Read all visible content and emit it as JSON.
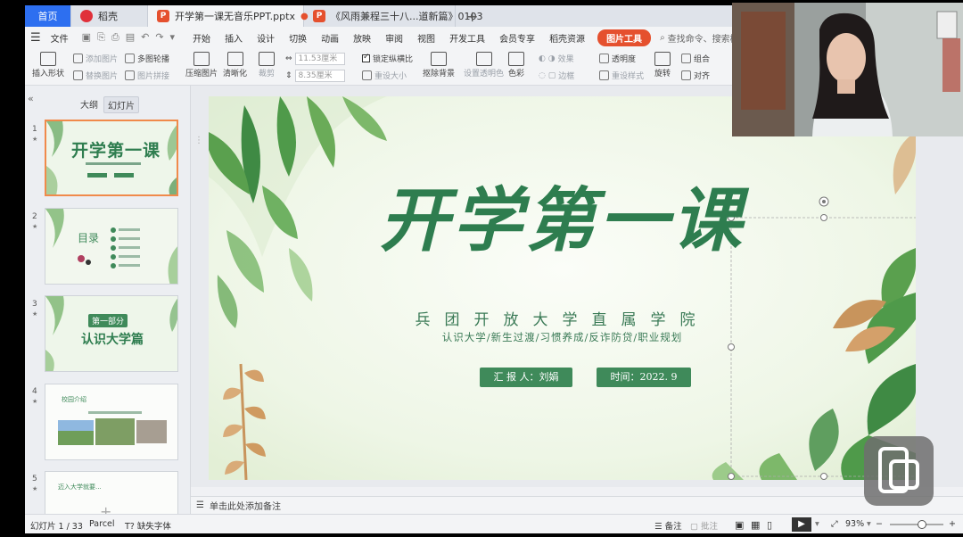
{
  "tabs": {
    "home": "首页",
    "wps": "稻壳",
    "active_doc": "开学第一课无音乐PPT.pptx",
    "other_doc": "《风雨兼程三十八...道新篇》0103",
    "add": "+"
  },
  "menubar": {
    "file": "文件",
    "items": [
      "开始",
      "插入",
      "设计",
      "切换",
      "动画",
      "放映",
      "审阅",
      "视图",
      "开发工具",
      "会员专享",
      "稻壳资源"
    ],
    "picture_tools": "图片工具",
    "search": "查找命令、搜索模板"
  },
  "ribbon": {
    "insert_shape": "插入形状",
    "add_picture": "添加图片",
    "multi_outline": "多图轮播",
    "replace_picture": "替换图片",
    "picture_combine": "图片拼接",
    "compress": "压缩图片",
    "sharpen": "清晰化",
    "crop": "裁剪",
    "width": "11.53厘米",
    "height": "8.35厘米",
    "lock_ratio": "锁定纵横比",
    "reset_size": "重设大小",
    "remove_bg": "抠除背景",
    "set_transparent": "设置透明色",
    "color": "色彩",
    "effects": "效果",
    "transparency": "透明度",
    "border": "边框",
    "reset_style": "重设样式",
    "rotate": "旋转",
    "group": "组合",
    "align": "对齐"
  },
  "panel": {
    "outline_tab": "大纲",
    "slides_tab": "幻灯片",
    "thumbs": [
      {
        "num": "1",
        "title": "开学第一课"
      },
      {
        "num": "2",
        "title": "目录"
      },
      {
        "num": "3",
        "badge": "第一部分",
        "title": "认识大学篇"
      },
      {
        "num": "4",
        "title": "校园介绍"
      },
      {
        "num": "5",
        "title": "迈入大学就要..."
      }
    ]
  },
  "slide": {
    "title": "开学第一课",
    "college": "兵团开放大学直属学院",
    "subtitle": "认识大学/新生过渡/习惯养成/反诈防贷/职业规划",
    "reporter": "汇 报 人：刘娟",
    "time": "时间：2022. 9"
  },
  "notes": {
    "placeholder": "单击此处添加备注"
  },
  "status": {
    "slide_count": "幻灯片 1 / 33",
    "theme": "Parcel",
    "missing_font": "缺失字体",
    "notes": "备注",
    "comment": "批注",
    "zoom": "93%",
    "zoom_minus": "−",
    "zoom_plus": "+",
    "zoom_level": 0.6
  },
  "colors": {
    "accent": "#e5502e",
    "brand_blue": "#2d6ff0",
    "slide_green": "#2e7d4f"
  }
}
